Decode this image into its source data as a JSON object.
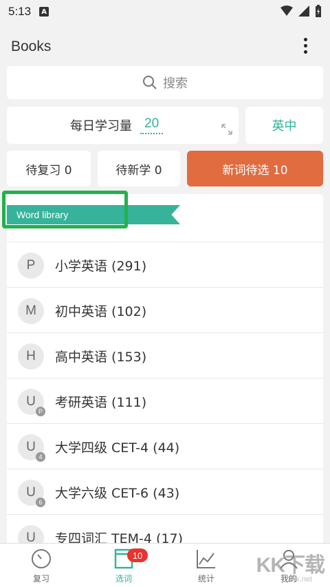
{
  "status_bar": {
    "time": "5:13",
    "notification_icon": "A"
  },
  "app_bar": {
    "title": "Books",
    "more_icon": "more-vert-icon"
  },
  "search": {
    "placeholder": "搜索"
  },
  "daily": {
    "label": "每日学习量",
    "value": "20",
    "expand_icon": "expand-icon"
  },
  "language": {
    "label": "英中"
  },
  "tabs": {
    "review": "待复习 0",
    "new": "待新学 0",
    "pending": "新词待选 10"
  },
  "colors": {
    "accent": "#2eb398",
    "orange": "#e06c40",
    "badge_red": "#e8332e",
    "highlight_green": "#22b14c"
  },
  "library": {
    "ribbon": "Word library",
    "items": [
      {
        "avatar": "P",
        "badge": "",
        "label": "小学英语 (291)"
      },
      {
        "avatar": "M",
        "badge": "",
        "label": "初中英语 (102)"
      },
      {
        "avatar": "H",
        "badge": "",
        "label": "高中英语 (153)"
      },
      {
        "avatar": "U",
        "badge": "P",
        "label": "考研英语 (111)"
      },
      {
        "avatar": "U",
        "badge": "4",
        "label": "大学四级 CET-4 (44)"
      },
      {
        "avatar": "U",
        "badge": "6",
        "label": "大学六级 CET-6 (43)"
      },
      {
        "avatar": "U",
        "badge": "",
        "label": "专四词汇 TEM-4 (17)"
      }
    ]
  },
  "bottom_nav": {
    "review": "复习",
    "select": "选词",
    "select_badge": "10",
    "stats": "统计",
    "mine": "我的"
  },
  "watermark": {
    "text": "KK下载",
    "sub": "kkx.net"
  }
}
